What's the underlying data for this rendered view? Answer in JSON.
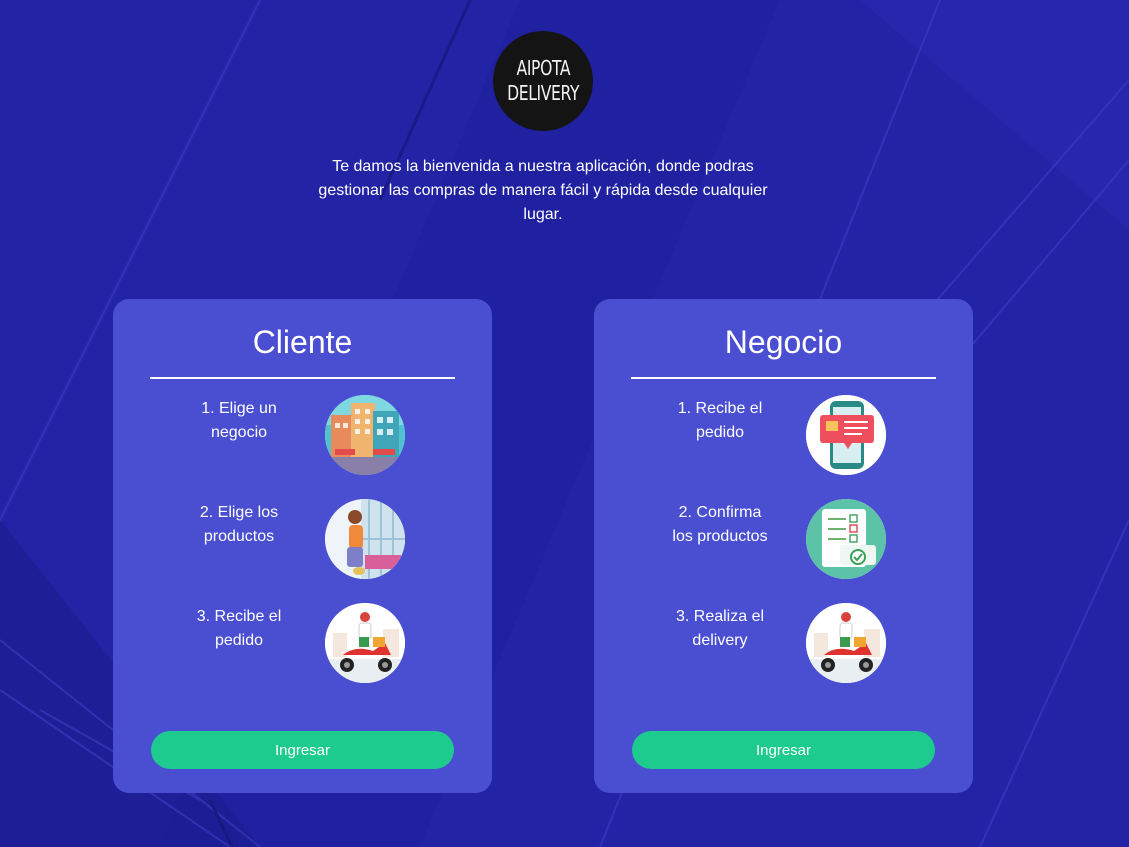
{
  "logo": {
    "line1": "AIPOTA",
    "line2": "DELIVERY"
  },
  "welcome": "Te damos la bienvenida a nuestra aplicación, donde podras gestionar las compras de manera fácil y rápida desde cualquier lugar.",
  "cards": {
    "cliente": {
      "title": "Cliente",
      "steps": [
        {
          "text": "1. Elige un negocio",
          "icon": "city-buildings-icon"
        },
        {
          "text": "2. Elige los productos",
          "icon": "shopping-woman-icon"
        },
        {
          "text": "3. Recibe el pedido",
          "icon": "delivery-scooter-icon"
        }
      ],
      "button": "Ingresar"
    },
    "negocio": {
      "title": "Negocio",
      "steps": [
        {
          "text": "1. Recibe el pedido",
          "icon": "phone-order-icon"
        },
        {
          "text": "2. Confirma los productos",
          "icon": "checklist-icon"
        },
        {
          "text": "3. Realiza el delivery",
          "icon": "delivery-scooter-icon"
        }
      ],
      "button": "Ingresar"
    }
  },
  "colors": {
    "background": "#2323a6",
    "card": "#4a4ed0",
    "button": "#1ccb8d",
    "text": "#ffffff"
  }
}
